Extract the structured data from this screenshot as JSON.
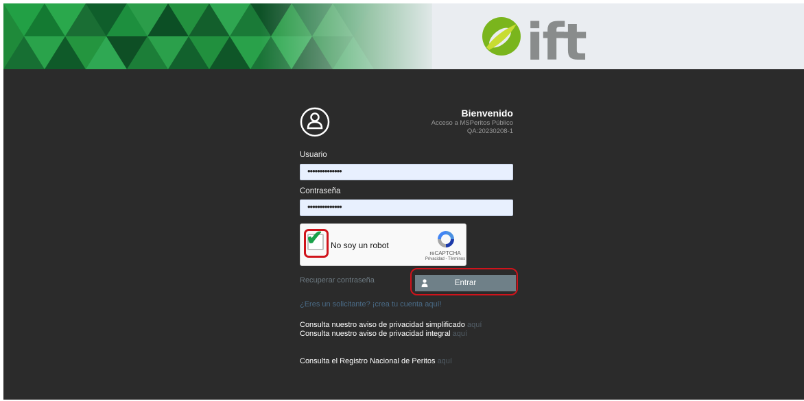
{
  "banner": {
    "brand_name": "ift",
    "colors": {
      "brand_gray": "#898c8c",
      "brand_green": "#7ab51d",
      "banner_green": "#1f8a3a"
    }
  },
  "login": {
    "title": "Bienvenido",
    "subtitle": "Acceso a MSPeritos Público",
    "version": "QA:20230208-1",
    "username_label": "Usuario",
    "username_value": "••••••••••••••",
    "password_label": "Contraseña",
    "password_value": "••••••••••••••",
    "recaptcha": {
      "label": "No soy un robot",
      "checked": true,
      "brand": "reCAPTCHA",
      "terms": "Privacidad - Términos"
    },
    "recover_link": "Recuperar contraseña",
    "enter_button": "Entrar",
    "signup_link": "¿Eres un solicitante? ¡crea tu cuenta aquí!"
  },
  "notices": {
    "simplified_text": "Consulta nuestro aviso de privacidad simplificado",
    "simplified_link": "aquí",
    "integral_text": "Consulta nuestro aviso de privacidad integral",
    "integral_link": "aquí",
    "registry_text": "Consulta el Registro Nacional de Peritos",
    "registry_link": "aquí"
  },
  "annotations": {
    "highlight_color": "#d0131b"
  }
}
